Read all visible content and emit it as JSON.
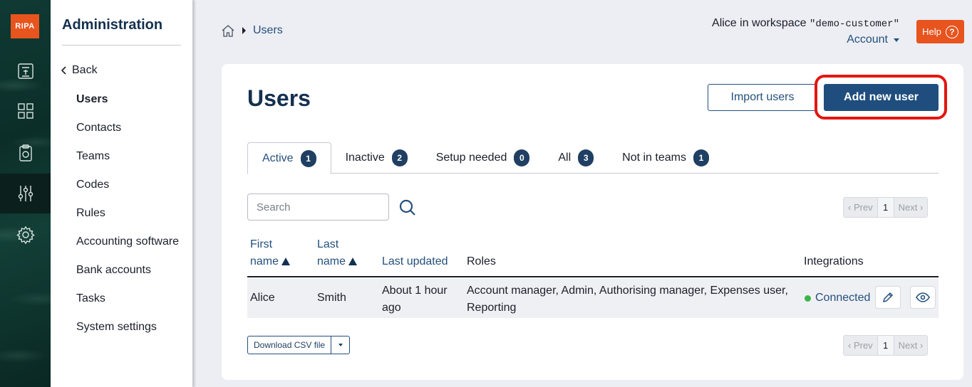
{
  "rail": {
    "logo": "RIPA",
    "icons": [
      "receipt-icon",
      "dashboard-grid-icon",
      "clipboard-icon",
      "sliders-icon",
      "gear-icon"
    ]
  },
  "sidebar": {
    "title": "Administration",
    "back_label": "Back",
    "items": [
      {
        "label": "Users",
        "active": true
      },
      {
        "label": "Contacts"
      },
      {
        "label": "Teams"
      },
      {
        "label": "Codes"
      },
      {
        "label": "Rules"
      },
      {
        "label": "Accounting software"
      },
      {
        "label": "Bank accounts"
      },
      {
        "label": "Tasks"
      },
      {
        "label": "System settings"
      }
    ]
  },
  "header": {
    "breadcrumb_current": "Users",
    "workspace_prefix": "Alice in workspace ",
    "workspace_name": "\"demo-customer\"",
    "account_label": "Account",
    "help_label": "Help",
    "help_glyph": "?"
  },
  "main": {
    "title": "Users",
    "import_label": "Import users",
    "add_label": "Add new user",
    "tabs": [
      {
        "label": "Active",
        "count": "1"
      },
      {
        "label": "Inactive",
        "count": "2"
      },
      {
        "label": "Setup needed",
        "count": "0"
      },
      {
        "label": "All",
        "count": "3"
      },
      {
        "label": "Not in teams",
        "count": "1"
      }
    ],
    "search_placeholder": "Search",
    "pager": {
      "prev": "‹ Prev",
      "page": "1",
      "next": "Next ›"
    },
    "columns": {
      "first_name_1": "First",
      "first_name_2": "name",
      "last_name_1": "Last",
      "last_name_2": "name",
      "last_updated": "Last updated",
      "roles": "Roles",
      "integrations": "Integrations"
    },
    "rows": [
      {
        "first": "Alice",
        "last": "Smith",
        "updated_1": "About 1 hour",
        "updated_2": "ago",
        "roles_1": "Account manager, Admin, Authorising manager, Expenses user,",
        "roles_2": "Reporting",
        "integration": "Connected"
      }
    ],
    "csv_label": "Download CSV file"
  },
  "colors": {
    "brand_orange": "#e8541e",
    "primary_blue": "#1f4e7e",
    "highlight_red": "#e3160f",
    "connected_green": "#3bb54a"
  }
}
